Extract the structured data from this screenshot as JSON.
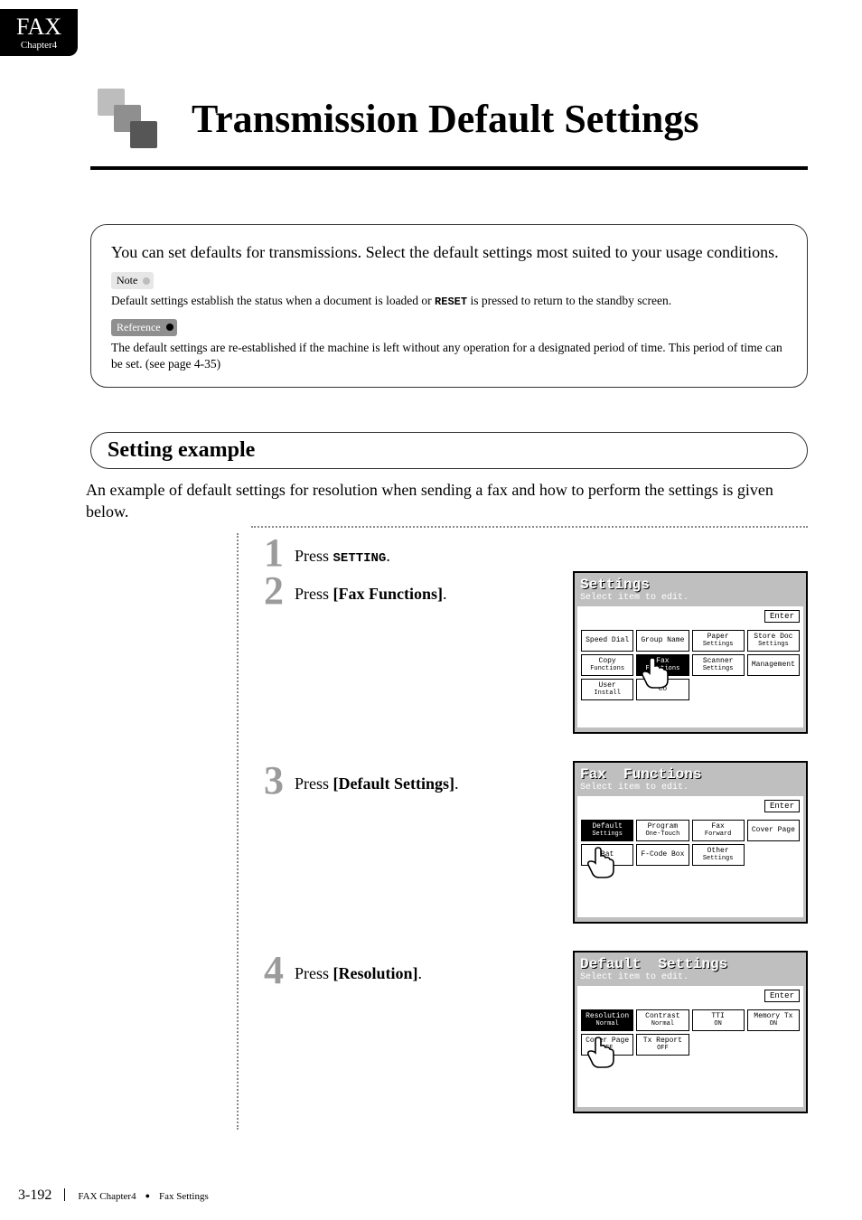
{
  "tab": {
    "title": "FAX",
    "subtitle": "Chapter4"
  },
  "page_title": "Transmission Default Settings",
  "intro": {
    "lead": "You can set defaults for transmissions. Select the default settings most suited to your usage conditions.",
    "note_label": "Note",
    "note_text_pre": "Default settings establish the status when a document is loaded or ",
    "note_kbd": "RESET",
    "note_text_post": " is pressed to return to the standby screen.",
    "ref_label": "Reference",
    "ref_text": "The default settings are re-established if the machine is left without any operation for a designated period of time. This period of time can be set. (see page 4-35)"
  },
  "section_heading": "Setting example",
  "section_text": "An example of default settings for resolution when sending a fax and how to perform the settings is given below.",
  "steps": [
    {
      "num": "1",
      "pre": "Press ",
      "kbd": "SETTING",
      "post": "."
    },
    {
      "num": "2",
      "pre": "Press ",
      "bold": "[Fax Functions]",
      "post": "."
    },
    {
      "num": "3",
      "pre": "Press ",
      "bold": "[Default Settings]",
      "post": "."
    },
    {
      "num": "4",
      "pre": "Press ",
      "bold": "[Resolution]",
      "post": "."
    }
  ],
  "screens": {
    "settings": {
      "title": "Settings",
      "subtitle": "Select item to edit.",
      "enter": "Enter",
      "buttons": [
        [
          "Speed Dial",
          ""
        ],
        [
          "Group Name",
          ""
        ],
        [
          "Paper",
          "Settings"
        ],
        [
          "Store Doc",
          "Settings"
        ],
        [
          "Copy",
          "Functions"
        ],
        [
          "Fax",
          "Functions"
        ],
        [
          "Scanner",
          "Settings"
        ],
        [
          "Management",
          ""
        ],
        [
          "User",
          "Install"
        ],
        [
          "Co",
          ""
        ]
      ],
      "selected_index": 5
    },
    "fax_functions": {
      "title": "Fax  Functions",
      "subtitle": "Select item to edit.",
      "enter": "Enter",
      "buttons": [
        [
          "Default",
          "Settings"
        ],
        [
          "Program",
          "One-Touch"
        ],
        [
          "Fax",
          "Forward"
        ],
        [
          "Cover Page",
          ""
        ],
        [
          "Bat",
          ""
        ],
        [
          "F-Code Box",
          ""
        ],
        [
          "Other",
          "Settings"
        ]
      ],
      "selected_index": 0
    },
    "default_settings": {
      "title": "Default  Settings",
      "subtitle": "Select item to edit.",
      "enter": "Enter",
      "buttons": [
        [
          "Resolution",
          "Normal"
        ],
        [
          "Contrast",
          "Normal"
        ],
        [
          "TTI",
          "ON"
        ],
        [
          "Memory Tx",
          "ON"
        ],
        [
          "Cover Page",
          "OFF"
        ],
        [
          "Tx Report",
          "OFF"
        ]
      ],
      "selected_index": 0
    }
  },
  "footer": {
    "page_number": "3-192",
    "crumb_left": "FAX Chapter4",
    "crumb_right": "Fax Settings"
  }
}
